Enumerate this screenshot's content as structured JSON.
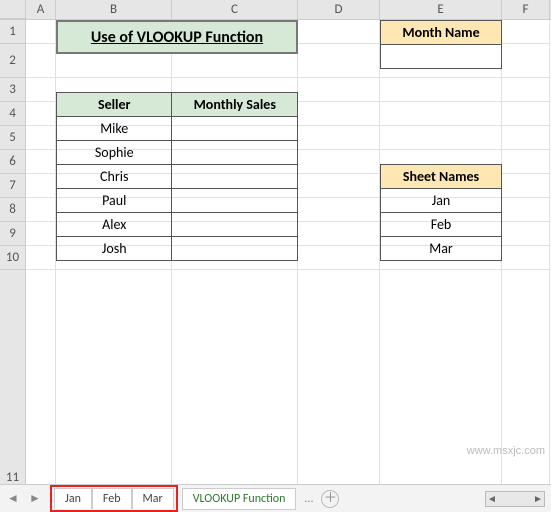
{
  "columns": [
    "A",
    "B",
    "C",
    "D",
    "E",
    "F"
  ],
  "rows": [
    "1",
    "2",
    "3",
    "4",
    "5",
    "6",
    "7",
    "8",
    "9",
    "10",
    "11"
  ],
  "title": "Use of VLOOKUP Function",
  "seller_table": {
    "headers": [
      "Seller",
      "Monthly Sales"
    ],
    "rows": [
      {
        "seller": "Mike",
        "sales": ""
      },
      {
        "seller": "Sophie",
        "sales": ""
      },
      {
        "seller": "Chris",
        "sales": ""
      },
      {
        "seller": "Paul",
        "sales": ""
      },
      {
        "seller": "Alex",
        "sales": ""
      },
      {
        "seller": "Josh",
        "sales": ""
      }
    ]
  },
  "month_name": {
    "header": "Month Name",
    "value": ""
  },
  "sheet_names": {
    "header": "Sheet Names",
    "values": [
      "Jan",
      "Feb",
      "Mar"
    ]
  },
  "tabs": {
    "highlighted": [
      "Jan",
      "Feb",
      "Mar"
    ],
    "active": "VLOOKUP Function",
    "more": "..."
  },
  "watermark": "www.msxjc.com"
}
